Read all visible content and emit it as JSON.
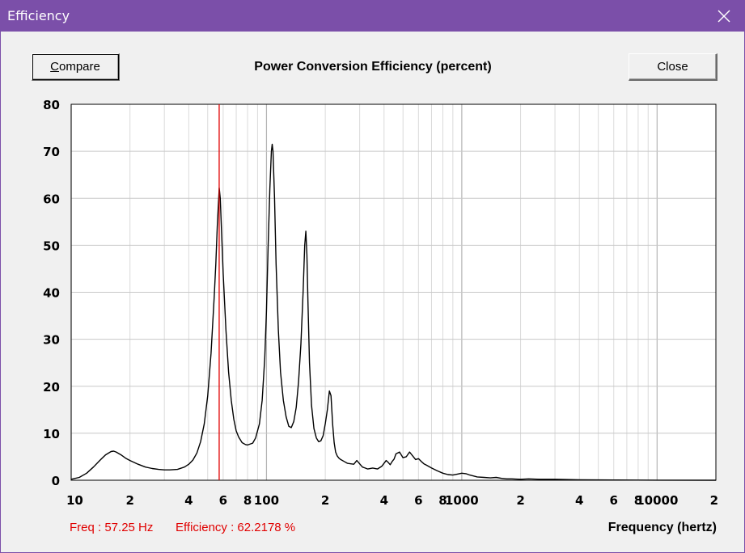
{
  "window": {
    "title": "Efficiency",
    "close_icon": "close-icon"
  },
  "toolbar": {
    "compare_label_first": "C",
    "compare_label_rest": "ompare",
    "close_label": "Close"
  },
  "readout": {
    "freq": "Freq : 57.25 Hz",
    "efficiency": "Efficiency : 62.2178 %"
  },
  "colors": {
    "titlebar": "#7b4fa9",
    "cursor": "#e00000",
    "trace": "#000000",
    "grid": "#c8c8c8"
  },
  "chart_data": {
    "type": "line",
    "title": "Power Conversion Efficiency (percent)",
    "xlabel": "Frequency (hertz)",
    "ylabel": "",
    "x_scale": "log",
    "xlim": [
      10,
      20000
    ],
    "ylim": [
      0,
      80
    ],
    "grid": true,
    "y_ticks": [
      "0",
      "10",
      "20",
      "30",
      "40",
      "50",
      "60",
      "70",
      "80"
    ],
    "x_ticks": [
      {
        "value": 10,
        "label": "10"
      },
      {
        "value": 20,
        "label": "2"
      },
      {
        "value": 40,
        "label": "4"
      },
      {
        "value": 60,
        "label": "6"
      },
      {
        "value": 80,
        "label": "8"
      },
      {
        "value": 100,
        "label": "100"
      },
      {
        "value": 200,
        "label": "2"
      },
      {
        "value": 400,
        "label": "4"
      },
      {
        "value": 600,
        "label": "6"
      },
      {
        "value": 800,
        "label": "8"
      },
      {
        "value": 1000,
        "label": "1000"
      },
      {
        "value": 2000,
        "label": "2"
      },
      {
        "value": 4000,
        "label": "4"
      },
      {
        "value": 6000,
        "label": "6"
      },
      {
        "value": 8000,
        "label": "8"
      },
      {
        "value": 10000,
        "label": "10000"
      },
      {
        "value": 20000,
        "label": "2"
      }
    ],
    "cursor_x": 57.25,
    "series": [
      {
        "x": [
          10,
          11,
          12,
          13,
          14,
          15,
          16,
          16.5,
          17,
          18,
          19,
          20,
          22,
          24,
          26,
          28,
          30,
          32,
          35,
          38,
          40,
          42,
          44,
          46,
          48,
          50,
          52,
          54,
          55,
          56,
          57.25,
          58,
          59,
          60,
          62,
          64,
          66,
          68,
          70,
          72,
          75,
          78,
          80,
          85,
          88,
          92,
          95,
          98,
          100,
          102,
          104,
          106,
          107,
          108,
          110,
          112,
          115,
          118,
          122,
          126,
          130,
          134,
          138,
          142,
          146,
          150,
          154,
          157,
          159,
          161,
          163,
          166,
          170,
          175,
          180,
          185,
          190,
          195,
          200,
          205,
          210,
          214,
          218,
          222,
          226,
          230,
          235,
          240,
          250,
          260,
          270,
          280,
          290,
          300,
          310,
          320,
          330,
          350,
          370,
          390,
          410,
          420,
          430,
          440,
          450,
          460,
          480,
          500,
          520,
          530,
          540,
          560,
          580,
          600,
          620,
          640,
          660,
          700,
          750,
          800,
          850,
          900,
          950,
          1000,
          1050,
          1100,
          1200,
          1300,
          1400,
          1500,
          1600,
          1700,
          1800,
          2000,
          2200,
          2500,
          3000,
          4000,
          6000,
          10000,
          20000
        ],
        "y": [
          0.2,
          0.6,
          1.5,
          2.8,
          4.2,
          5.4,
          6.1,
          6.2,
          6.0,
          5.4,
          4.7,
          4.2,
          3.4,
          2.8,
          2.5,
          2.3,
          2.2,
          2.2,
          2.3,
          2.8,
          3.4,
          4.3,
          5.8,
          8.2,
          12.0,
          18.0,
          27.0,
          39.0,
          46.0,
          54.0,
          62.2,
          60.0,
          52.0,
          44.0,
          32.0,
          23.0,
          17.0,
          13.0,
          10.5,
          9.2,
          8.0,
          7.6,
          7.5,
          7.9,
          9.0,
          12.0,
          17.0,
          26.0,
          36.0,
          50.0,
          62.0,
          70.0,
          71.5,
          70.0,
          60.0,
          46.0,
          32.0,
          23.0,
          17.0,
          13.5,
          11.5,
          11.2,
          12.5,
          15.5,
          21.0,
          29.0,
          40.0,
          50.0,
          53.0,
          48.0,
          38.0,
          25.0,
          16.0,
          11.0,
          9.0,
          8.2,
          8.4,
          9.5,
          12.0,
          15.0,
          19.0,
          18.0,
          12.0,
          8.0,
          6.0,
          5.2,
          4.7,
          4.4,
          4.0,
          3.6,
          3.5,
          3.4,
          4.2,
          3.5,
          2.8,
          2.6,
          2.4,
          2.6,
          2.4,
          3.0,
          4.2,
          3.8,
          3.3,
          4.0,
          4.5,
          5.6,
          6.0,
          4.8,
          5.0,
          5.5,
          6.0,
          5.2,
          4.4,
          4.6,
          4.0,
          3.5,
          3.2,
          2.6,
          2.0,
          1.5,
          1.2,
          1.1,
          1.3,
          1.5,
          1.4,
          1.1,
          0.7,
          0.6,
          0.5,
          0.6,
          0.4,
          0.3,
          0.3,
          0.2,
          0.3,
          0.2,
          0.2,
          0.1,
          0.05,
          0.02,
          0.0
        ]
      }
    ]
  }
}
